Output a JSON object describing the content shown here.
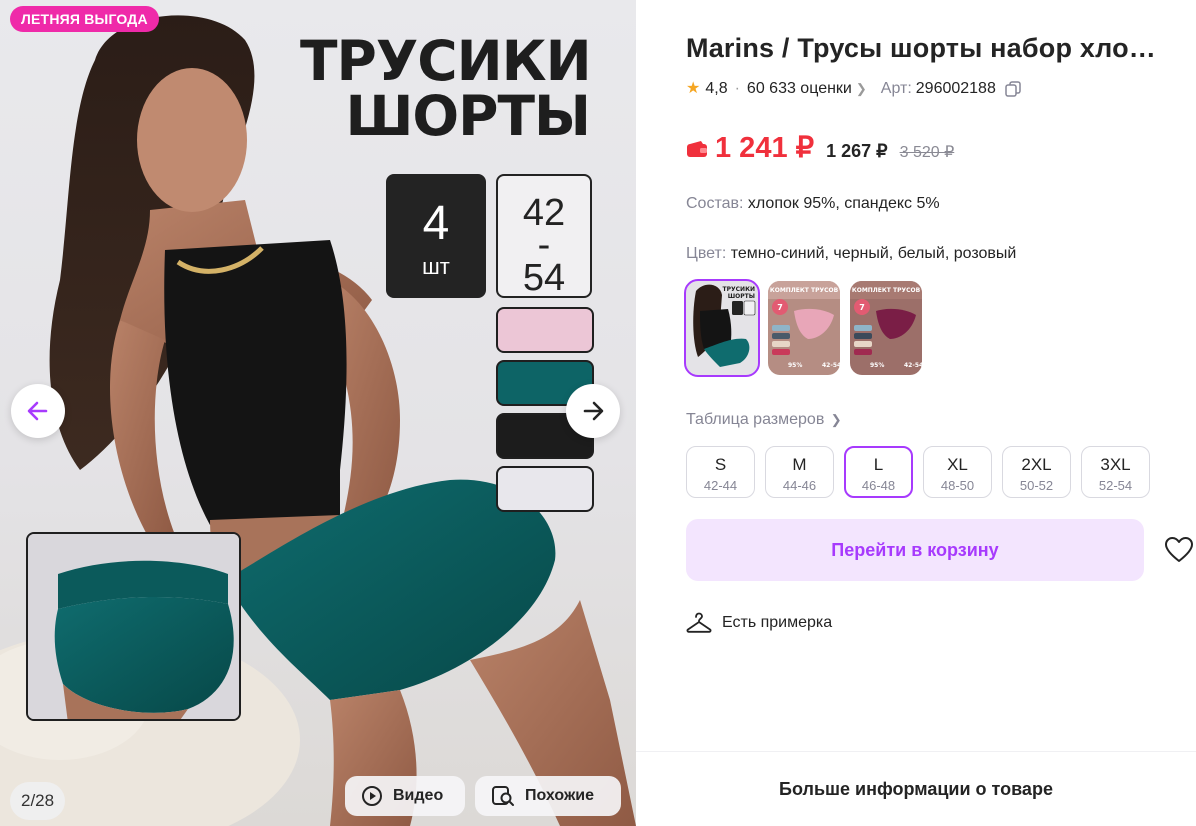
{
  "gallery": {
    "badge": "ЛЕТНЯЯ ВЫГОДА",
    "photo_title_line1": "ТРУСИКИ",
    "photo_title_line2": "ШОРТЫ",
    "count_number": "4",
    "count_unit": "шт",
    "size_from": "42",
    "size_dash": "-",
    "size_to": "54",
    "swatch_colors": [
      "#ecc6d6",
      "#0d6466",
      "#1c1c1c",
      "#e8e7ec"
    ],
    "counter": "2/28",
    "video_label": "Видео",
    "similar_label": "Похожие",
    "current_image": 2,
    "total_images": 28
  },
  "product": {
    "title": "Marins / Трусы шорты набор хло…",
    "rating": "4,8",
    "reviews": "60 633 оценки",
    "article_label": "Арт:",
    "article": "296002188"
  },
  "price": {
    "main": "1 241 ₽",
    "wallet": "1 267 ₽",
    "old": "3 520 ₽",
    "accent_color": "#f0303c"
  },
  "composition": {
    "label": "Состав:",
    "value": "хлопок 95%, спандекс 5%"
  },
  "color": {
    "label": "Цвет:",
    "value": "темно-синий, черный, белый, розовый"
  },
  "color_thumbnails": [
    {
      "title": "ТРУСИКИ ШОРТЫ",
      "selected": true
    },
    {
      "title": "КОМПЛЕКТ ТРУСОВ",
      "badge": "7 шт",
      "note": "95%",
      "sizes": "42-54",
      "selected": false
    },
    {
      "title": "КОМПЛЕКТ ТРУСОВ",
      "badge": "7 шт",
      "note": "95%",
      "sizes": "42-54",
      "selected": false
    }
  ],
  "size_table_label": "Таблица размеров",
  "sizes": [
    {
      "label": "S",
      "range": "42-44",
      "selected": false
    },
    {
      "label": "M",
      "range": "44-46",
      "selected": false
    },
    {
      "label": "L",
      "range": "46-48",
      "selected": true
    },
    {
      "label": "XL",
      "range": "48-50",
      "selected": false
    },
    {
      "label": "2XL",
      "range": "50-52",
      "selected": false
    },
    {
      "label": "3XL",
      "range": "52-54",
      "selected": false
    }
  ],
  "cart_button": "Перейти в корзину",
  "tryon": "Есть примерка",
  "more_info": "Больше информации о товаре",
  "brand_color": "#a73afd"
}
